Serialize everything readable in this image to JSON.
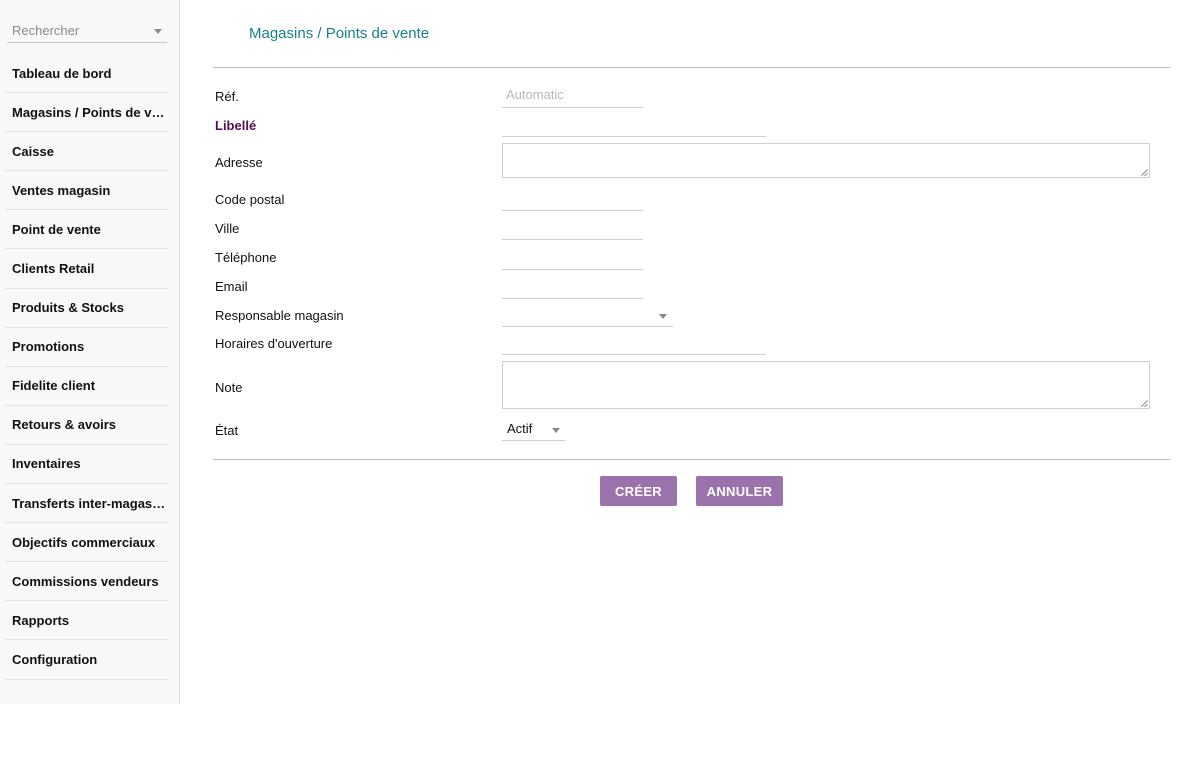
{
  "search": {
    "placeholder": "Rechercher",
    "icon": "caret-down-icon"
  },
  "sidebar": {
    "items": [
      {
        "label": "Tableau de bord"
      },
      {
        "label": "Magasins / Points de vente"
      },
      {
        "label": "Caisse"
      },
      {
        "label": "Ventes magasin"
      },
      {
        "label": "Point de vente"
      },
      {
        "label": "Clients Retail"
      },
      {
        "label": "Produits & Stocks"
      },
      {
        "label": "Promotions"
      },
      {
        "label": "Fidelite client"
      },
      {
        "label": "Retours & avoirs"
      },
      {
        "label": "Inventaires"
      },
      {
        "label": "Transferts inter-magasins"
      },
      {
        "label": "Objectifs commerciaux"
      },
      {
        "label": "Commissions vendeurs"
      },
      {
        "label": "Rapports"
      },
      {
        "label": "Configuration"
      }
    ]
  },
  "page": {
    "title": "Magasins / Points de vente"
  },
  "form": {
    "ref": {
      "label": "Réf.",
      "placeholder": "Automatic",
      "value": ""
    },
    "libelle": {
      "label": "Libellé",
      "value": ""
    },
    "adresse": {
      "label": "Adresse",
      "value": ""
    },
    "code_postal": {
      "label": "Code postal",
      "value": ""
    },
    "ville": {
      "label": "Ville",
      "value": ""
    },
    "telephone": {
      "label": "Téléphone",
      "value": ""
    },
    "email": {
      "label": "Email",
      "value": ""
    },
    "responsable": {
      "label": "Responsable magasin",
      "value": ""
    },
    "horaires": {
      "label": "Horaires d'ouverture",
      "value": ""
    },
    "note": {
      "label": "Note",
      "value": ""
    },
    "etat": {
      "label": "État",
      "value": "Actif"
    }
  },
  "actions": {
    "create_label": "CRÉER",
    "cancel_label": "ANNULER"
  },
  "colors": {
    "accent_button": "#9b73ac",
    "title": "#1a7f86",
    "required_label": "#5a0f4f",
    "sidebar_bg": "#f8f8f8"
  }
}
